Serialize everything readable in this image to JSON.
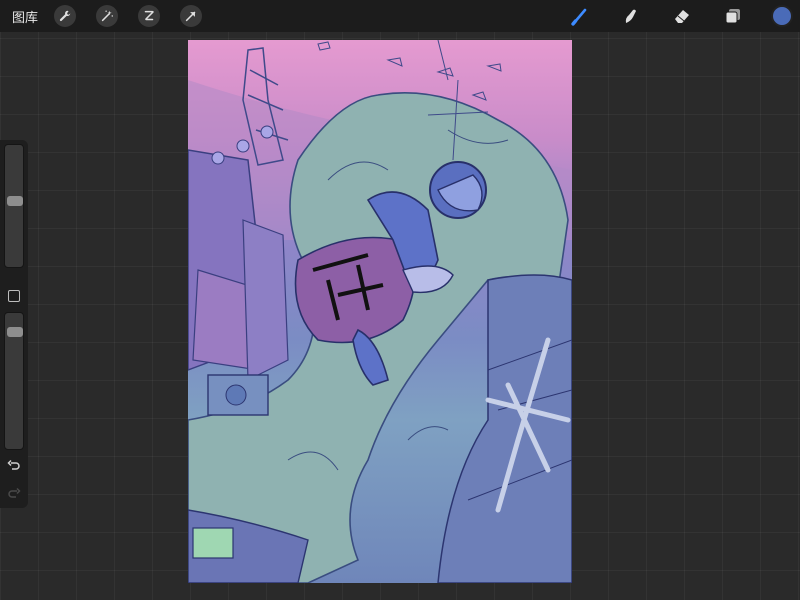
{
  "topbar": {
    "gallery_label": "图库",
    "left_tools": [
      {
        "icon": "wrench-icon"
      },
      {
        "icon": "magic-wand-icon"
      },
      {
        "icon": "selection-icon"
      },
      {
        "icon": "arrow-cursor-icon"
      }
    ],
    "right_tools": [
      {
        "icon": "brush-icon",
        "active": true
      },
      {
        "icon": "smudge-icon",
        "active": false
      },
      {
        "icon": "eraser-icon",
        "active": false
      },
      {
        "icon": "layers-icon",
        "active": false
      }
    ],
    "current_color": "#4a6bb8"
  },
  "sidebar": {
    "brush_size": 0.55,
    "opacity": 0.9,
    "controls": [
      "modify-button",
      "undo-icon",
      "redo-icon"
    ]
  },
  "canvas": {
    "content": "artwork"
  },
  "colors": {
    "accent": "#3d8bff",
    "icon": "#e0e0e0",
    "topbar": "#1c1c1c"
  }
}
